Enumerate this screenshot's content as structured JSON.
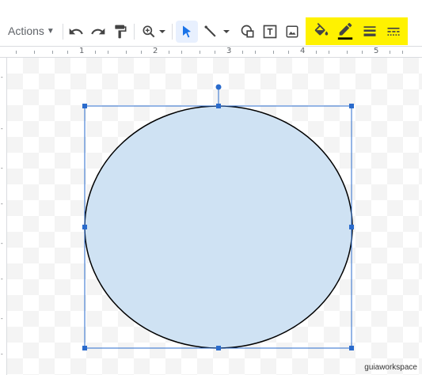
{
  "toolbar": {
    "actions_label": "Actions",
    "buttons": [
      "undo-icon",
      "redo-icon",
      "paint-format-icon",
      "zoom-icon",
      "select-icon",
      "line-icon",
      "shape-icon",
      "text-box-icon",
      "image-icon",
      "fill-color-icon",
      "border-color-icon",
      "border-weight-icon",
      "border-dash-icon"
    ],
    "highlight_color": "#fff200"
  },
  "ruler": {
    "labels": [
      "1",
      "2",
      "3",
      "4",
      "5"
    ]
  },
  "shape": {
    "type": "ellipse",
    "fill": "#cfe2f3",
    "stroke": "#000000",
    "selection_color": "#2a6bcc"
  },
  "watermark": "guiaworkspace"
}
